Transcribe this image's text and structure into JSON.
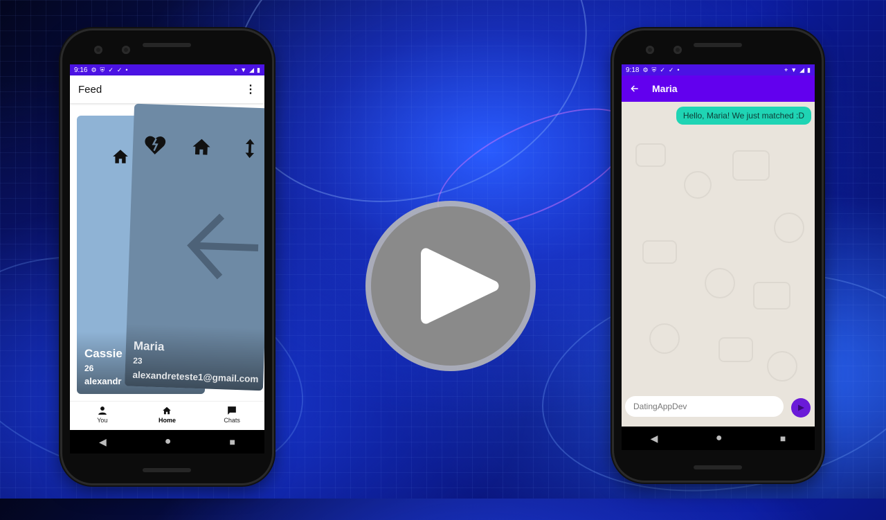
{
  "left_phone": {
    "status": {
      "time": "9:16"
    },
    "appbar": {
      "title": "Feed",
      "more_icon": "⋮"
    },
    "cards": {
      "back": {
        "name": "Cassie",
        "age": "26",
        "email": "alexandr"
      },
      "front": {
        "name": "Maria",
        "age": "23",
        "email": "alexandreteste1@gmail.com"
      }
    },
    "bottom_nav": [
      {
        "label": "You",
        "icon": "person-icon"
      },
      {
        "label": "Home",
        "icon": "home-icon",
        "active": true
      },
      {
        "label": "Chats",
        "icon": "chat-icon"
      }
    ]
  },
  "right_phone": {
    "status": {
      "time": "9:18"
    },
    "chatbar": {
      "title": "Maria"
    },
    "messages": [
      {
        "text": "Hello, Maria! We just matched :D",
        "sender": "me"
      }
    ],
    "input": {
      "placeholder": "DatingAppDev"
    }
  },
  "play_button": {
    "icon": "play-icon"
  },
  "colors": {
    "status_bar": "#4b12e4",
    "chat_header": "#6200ee",
    "bubble": "#1fd4b4",
    "send_button": "#6a1bd8"
  }
}
